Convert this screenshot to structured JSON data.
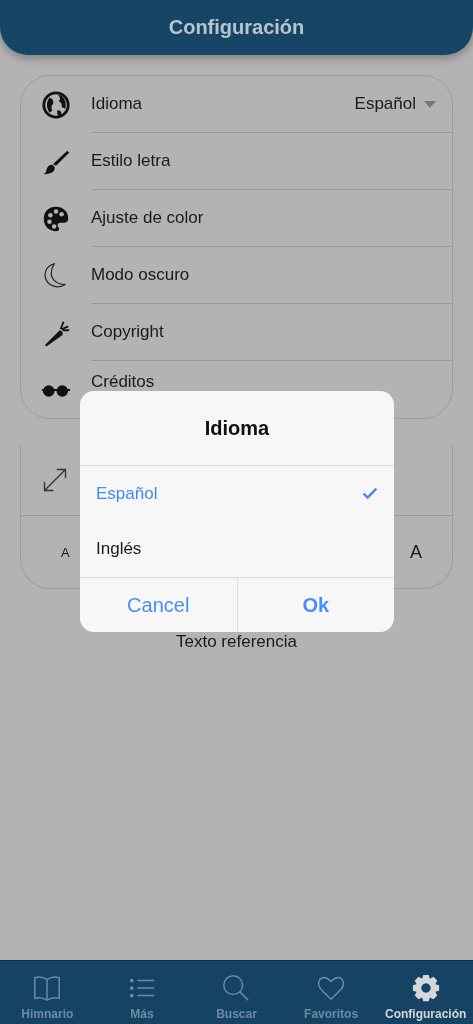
{
  "header": {
    "title": "Configuración"
  },
  "settings": [
    {
      "label": "Idioma",
      "value": "Español"
    },
    {
      "label": "Estilo letra"
    },
    {
      "label": "Ajuste de color"
    },
    {
      "label": "Modo oscuro"
    },
    {
      "label": "Copyright"
    },
    {
      "label": "Créditos"
    }
  ],
  "font_size": {
    "small_label": "A",
    "large_label": "A",
    "preview": "Texto referencia"
  },
  "dialog": {
    "title": "Idioma",
    "options": [
      {
        "label": "Español",
        "selected": true
      },
      {
        "label": "Inglés",
        "selected": false
      }
    ],
    "buttons": [
      "Cancel",
      "Ok"
    ]
  },
  "tabs": [
    {
      "label": "Himnario",
      "selected": false
    },
    {
      "label": "Más",
      "selected": false
    },
    {
      "label": "Buscar",
      "selected": false
    },
    {
      "label": "Favoritos",
      "selected": false
    },
    {
      "label": "Configuración",
      "selected": true
    }
  ]
}
